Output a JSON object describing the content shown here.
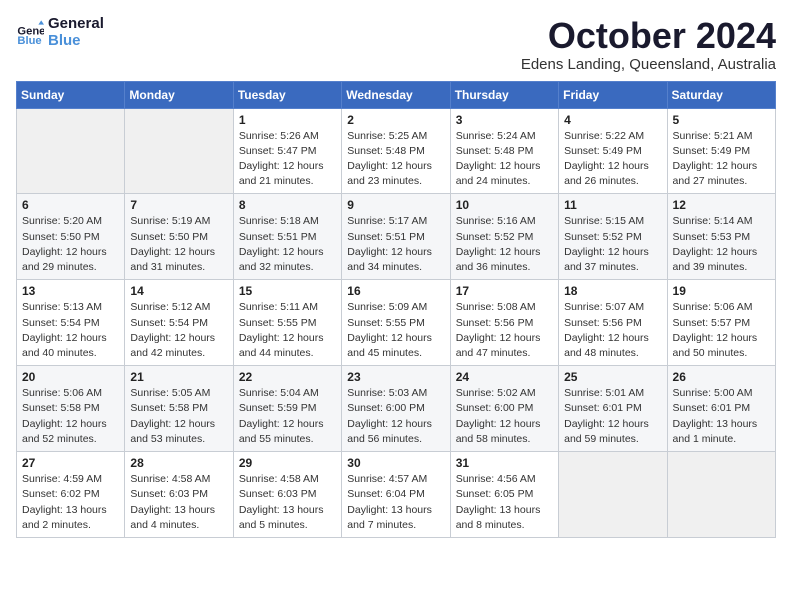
{
  "logo": {
    "line1": "General",
    "line2": "Blue"
  },
  "title": "October 2024",
  "location": "Edens Landing, Queensland, Australia",
  "days_of_week": [
    "Sunday",
    "Monday",
    "Tuesday",
    "Wednesday",
    "Thursday",
    "Friday",
    "Saturday"
  ],
  "weeks": [
    [
      {
        "day": "",
        "info": ""
      },
      {
        "day": "",
        "info": ""
      },
      {
        "day": "1",
        "info": "Sunrise: 5:26 AM\nSunset: 5:47 PM\nDaylight: 12 hours\nand 21 minutes."
      },
      {
        "day": "2",
        "info": "Sunrise: 5:25 AM\nSunset: 5:48 PM\nDaylight: 12 hours\nand 23 minutes."
      },
      {
        "day": "3",
        "info": "Sunrise: 5:24 AM\nSunset: 5:48 PM\nDaylight: 12 hours\nand 24 minutes."
      },
      {
        "day": "4",
        "info": "Sunrise: 5:22 AM\nSunset: 5:49 PM\nDaylight: 12 hours\nand 26 minutes."
      },
      {
        "day": "5",
        "info": "Sunrise: 5:21 AM\nSunset: 5:49 PM\nDaylight: 12 hours\nand 27 minutes."
      }
    ],
    [
      {
        "day": "6",
        "info": "Sunrise: 5:20 AM\nSunset: 5:50 PM\nDaylight: 12 hours\nand 29 minutes."
      },
      {
        "day": "7",
        "info": "Sunrise: 5:19 AM\nSunset: 5:50 PM\nDaylight: 12 hours\nand 31 minutes."
      },
      {
        "day": "8",
        "info": "Sunrise: 5:18 AM\nSunset: 5:51 PM\nDaylight: 12 hours\nand 32 minutes."
      },
      {
        "day": "9",
        "info": "Sunrise: 5:17 AM\nSunset: 5:51 PM\nDaylight: 12 hours\nand 34 minutes."
      },
      {
        "day": "10",
        "info": "Sunrise: 5:16 AM\nSunset: 5:52 PM\nDaylight: 12 hours\nand 36 minutes."
      },
      {
        "day": "11",
        "info": "Sunrise: 5:15 AM\nSunset: 5:52 PM\nDaylight: 12 hours\nand 37 minutes."
      },
      {
        "day": "12",
        "info": "Sunrise: 5:14 AM\nSunset: 5:53 PM\nDaylight: 12 hours\nand 39 minutes."
      }
    ],
    [
      {
        "day": "13",
        "info": "Sunrise: 5:13 AM\nSunset: 5:54 PM\nDaylight: 12 hours\nand 40 minutes."
      },
      {
        "day": "14",
        "info": "Sunrise: 5:12 AM\nSunset: 5:54 PM\nDaylight: 12 hours\nand 42 minutes."
      },
      {
        "day": "15",
        "info": "Sunrise: 5:11 AM\nSunset: 5:55 PM\nDaylight: 12 hours\nand 44 minutes."
      },
      {
        "day": "16",
        "info": "Sunrise: 5:09 AM\nSunset: 5:55 PM\nDaylight: 12 hours\nand 45 minutes."
      },
      {
        "day": "17",
        "info": "Sunrise: 5:08 AM\nSunset: 5:56 PM\nDaylight: 12 hours\nand 47 minutes."
      },
      {
        "day": "18",
        "info": "Sunrise: 5:07 AM\nSunset: 5:56 PM\nDaylight: 12 hours\nand 48 minutes."
      },
      {
        "day": "19",
        "info": "Sunrise: 5:06 AM\nSunset: 5:57 PM\nDaylight: 12 hours\nand 50 minutes."
      }
    ],
    [
      {
        "day": "20",
        "info": "Sunrise: 5:06 AM\nSunset: 5:58 PM\nDaylight: 12 hours\nand 52 minutes."
      },
      {
        "day": "21",
        "info": "Sunrise: 5:05 AM\nSunset: 5:58 PM\nDaylight: 12 hours\nand 53 minutes."
      },
      {
        "day": "22",
        "info": "Sunrise: 5:04 AM\nSunset: 5:59 PM\nDaylight: 12 hours\nand 55 minutes."
      },
      {
        "day": "23",
        "info": "Sunrise: 5:03 AM\nSunset: 6:00 PM\nDaylight: 12 hours\nand 56 minutes."
      },
      {
        "day": "24",
        "info": "Sunrise: 5:02 AM\nSunset: 6:00 PM\nDaylight: 12 hours\nand 58 minutes."
      },
      {
        "day": "25",
        "info": "Sunrise: 5:01 AM\nSunset: 6:01 PM\nDaylight: 12 hours\nand 59 minutes."
      },
      {
        "day": "26",
        "info": "Sunrise: 5:00 AM\nSunset: 6:01 PM\nDaylight: 13 hours\nand 1 minute."
      }
    ],
    [
      {
        "day": "27",
        "info": "Sunrise: 4:59 AM\nSunset: 6:02 PM\nDaylight: 13 hours\nand 2 minutes."
      },
      {
        "day": "28",
        "info": "Sunrise: 4:58 AM\nSunset: 6:03 PM\nDaylight: 13 hours\nand 4 minutes."
      },
      {
        "day": "29",
        "info": "Sunrise: 4:58 AM\nSunset: 6:03 PM\nDaylight: 13 hours\nand 5 minutes."
      },
      {
        "day": "30",
        "info": "Sunrise: 4:57 AM\nSunset: 6:04 PM\nDaylight: 13 hours\nand 7 minutes."
      },
      {
        "day": "31",
        "info": "Sunrise: 4:56 AM\nSunset: 6:05 PM\nDaylight: 13 hours\nand 8 minutes."
      },
      {
        "day": "",
        "info": ""
      },
      {
        "day": "",
        "info": ""
      }
    ]
  ]
}
